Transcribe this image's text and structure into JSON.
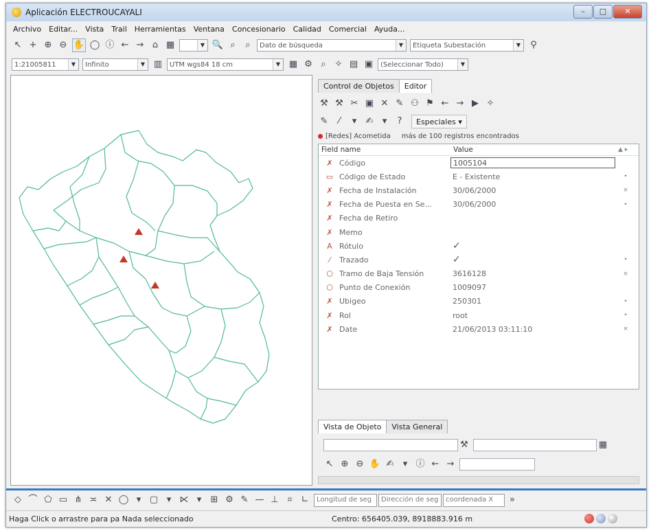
{
  "window": {
    "title": "Aplicación ELECTROUCAYALI",
    "min_label": "–",
    "max_label": "□",
    "close_label": "✕"
  },
  "menu": [
    "Archivo",
    "Editar...",
    "Vista",
    "Trail",
    "Herramientas",
    "Ventana",
    "Concesionario",
    "Calidad",
    "Comercial",
    "Ayuda..."
  ],
  "toolbar1": {
    "search_placeholder": "Dato de búsqueda",
    "label_combo": "Etiqueta Subestación"
  },
  "toolbar2": {
    "scale": "1:21005811",
    "range": "Infinito",
    "projection": "UTM wgs84 18 cm",
    "select_all": "(Seleccionar Todo)"
  },
  "panel": {
    "tabs": [
      "Control de Objetos",
      "Editor"
    ],
    "special_label": "Especiales",
    "status_layer": "[Redes] Acometida",
    "status_count": "más de 100 registros encontrados",
    "header_field": "Field name",
    "header_value": "Value",
    "rows": [
      {
        "icon": "red-x-icon",
        "glyph": "✗",
        "name": "Código",
        "value": "1005104",
        "mark": ""
      },
      {
        "icon": "table-icon",
        "glyph": "▭",
        "name": "Código de Estado",
        "value": "E - Existente",
        "mark": "•"
      },
      {
        "icon": "red-x-icon",
        "glyph": "✗",
        "name": "Fecha de Instalación",
        "value": "30/06/2000",
        "mark": "×"
      },
      {
        "icon": "red-x-icon",
        "glyph": "✗",
        "name": "Fecha de Puesta en Se...",
        "value": "30/06/2000",
        "mark": "•"
      },
      {
        "icon": "red-x-icon",
        "glyph": "✗",
        "name": "Fecha de Retiro",
        "value": "",
        "mark": ""
      },
      {
        "icon": "red-x-icon",
        "glyph": "✗",
        "name": "Memo",
        "value": "",
        "mark": ""
      },
      {
        "icon": "text-a-icon",
        "glyph": "A",
        "name": "Rótulo",
        "value": "✓",
        "mark": ""
      },
      {
        "icon": "line-icon",
        "glyph": "⁄",
        "name": "Trazado",
        "value": "✓",
        "mark": "•"
      },
      {
        "icon": "cube-icon",
        "glyph": "⬡",
        "name": "Tramo de Baja Tensión",
        "value": "3616128",
        "mark": "×"
      },
      {
        "icon": "cube-icon",
        "glyph": "⬡",
        "name": "Punto de Conexión",
        "value": "1009097",
        "mark": ""
      },
      {
        "icon": "red-x-icon",
        "glyph": "✗",
        "name": "Ubigeo",
        "value": "250301",
        "mark": "•"
      },
      {
        "icon": "red-x-icon",
        "glyph": "✗",
        "name": "Rol",
        "value": "root",
        "mark": "•"
      },
      {
        "icon": "red-x-icon",
        "glyph": "✗",
        "name": "Date",
        "value": "21/06/2013 03:11:10",
        "mark": "×"
      }
    ],
    "bottom_tabs": [
      "Vista de Objeto",
      "Vista General"
    ]
  },
  "bottom_toolbar": {
    "length_field": "Longitud de seg",
    "direction_field": "Dirección de seg",
    "coord_field": "coordenada X"
  },
  "status": {
    "left": "Haga Click o arrastre para pa Nada seleccionado",
    "center": "Centro: 656405.039, 8918883.916 m"
  },
  "colors": {
    "map_lines": "#4fb89a",
    "markers": "#c0392b",
    "taskbar_blue": "#3a76c5"
  }
}
